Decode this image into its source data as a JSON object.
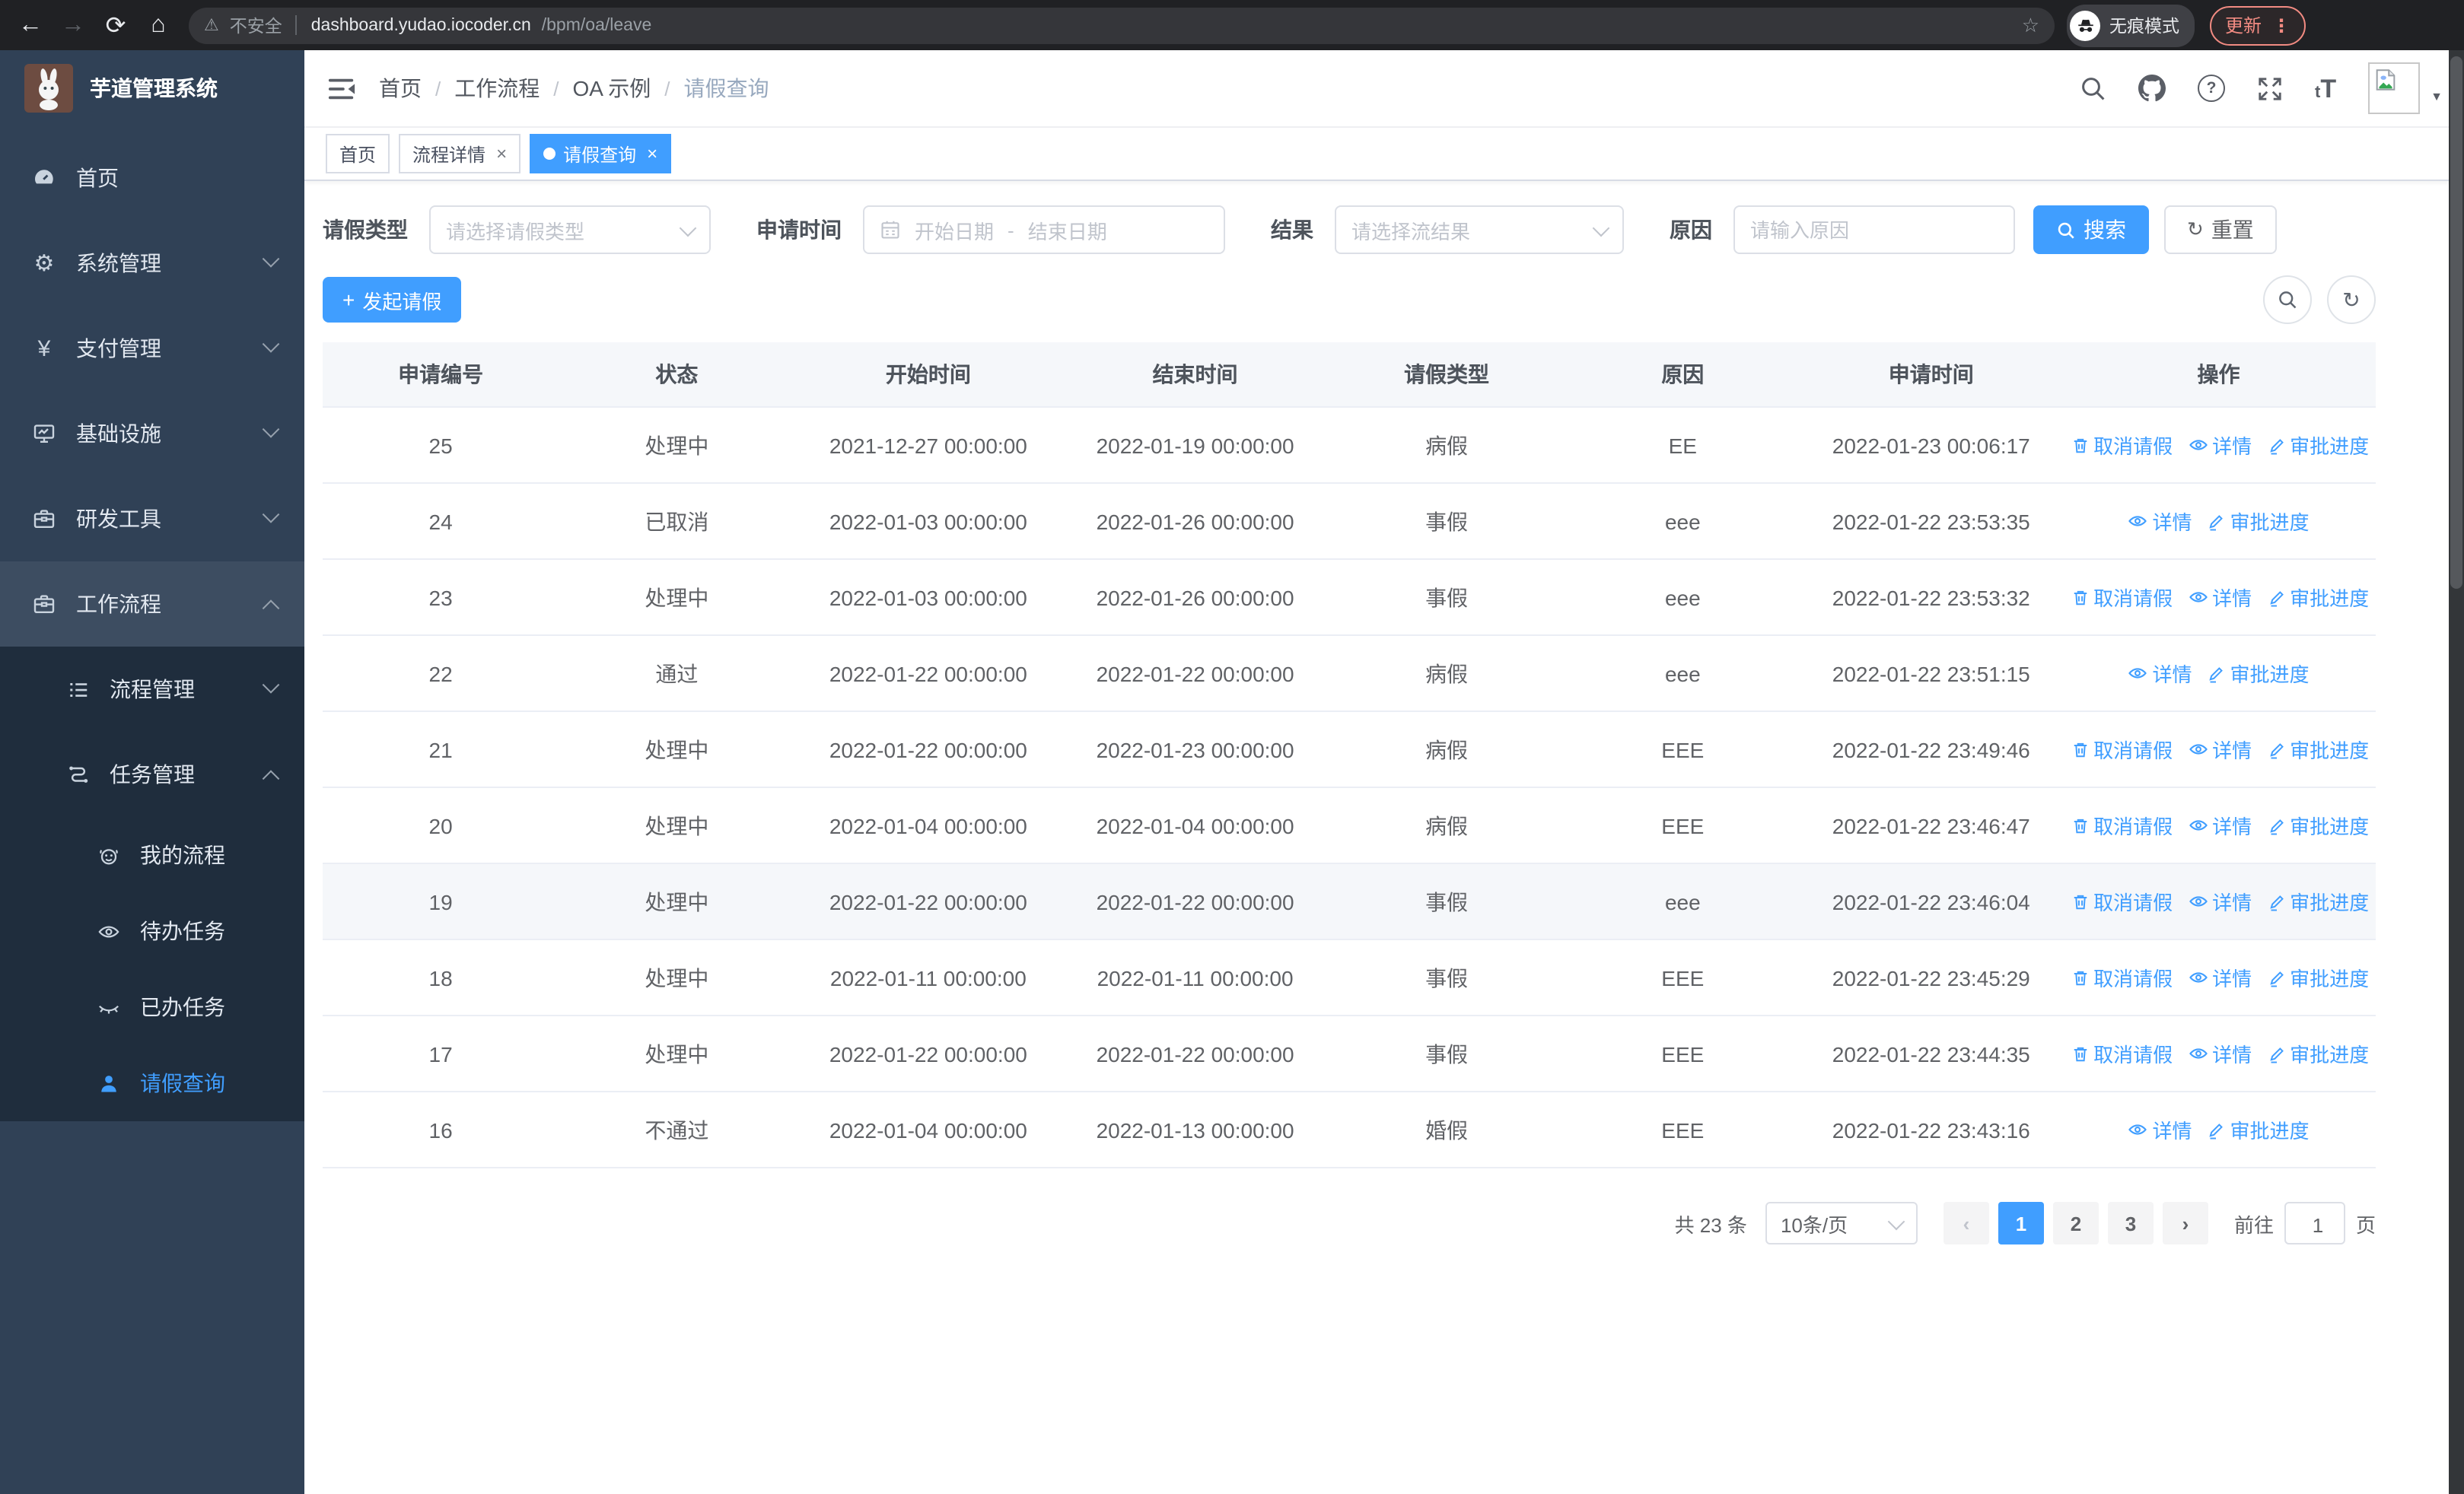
{
  "colors": {
    "primary": "#409eff",
    "sidebar_bg": "#304156",
    "submenu_bg": "#1f2d3d",
    "sidebar_active_text": "#409eff",
    "update_badge": "#f28b82",
    "table_header_bg": "#f5f7fa"
  },
  "icons": {
    "back": "←",
    "forward": "→",
    "reload": "⟳",
    "home": "⌂",
    "warning": "⚠",
    "star": "☆",
    "more": "⋮",
    "caret-down": "▼",
    "gear": "⚙",
    "yen": "¥",
    "plus": "+",
    "refresh": "↻",
    "prev": "‹",
    "next": "›",
    "font-size": "tT",
    "question": "?"
  },
  "browser": {
    "security_label": "不安全",
    "url_host": "dashboard.yudao.iocoder.cn",
    "url_path": "/bpm/oa/leave",
    "incognito_label": "无痕模式",
    "update_label": "更新"
  },
  "sidebar": {
    "title": "芋道管理系统",
    "menu": [
      {
        "label": "首页"
      },
      {
        "label": "系统管理"
      },
      {
        "label": "支付管理"
      },
      {
        "label": "基础设施"
      },
      {
        "label": "研发工具"
      },
      {
        "label": "工作流程"
      }
    ],
    "submenu": [
      {
        "label": "流程管理"
      },
      {
        "label": "任务管理"
      }
    ],
    "task_children": [
      {
        "label": "我的流程"
      },
      {
        "label": "待办任务"
      },
      {
        "label": "已办任务"
      },
      {
        "label": "请假查询"
      }
    ]
  },
  "navbar": {
    "breadcrumb": {
      "items": [
        "首页",
        "工作流程",
        "OA 示例",
        "请假查询"
      ],
      "separator": "/"
    }
  },
  "tabs": [
    {
      "label": "首页"
    },
    {
      "label": "流程详情",
      "close": "×"
    },
    {
      "label": "请假查询",
      "close": "×"
    }
  ],
  "filters": {
    "leave_type_label": "请假类型",
    "leave_type_placeholder": "请选择请假类型",
    "apply_time_label": "申请时间",
    "date_start_placeholder": "开始日期",
    "date_separator": "-",
    "date_end_placeholder": "结束日期",
    "result_label": "结果",
    "result_placeholder": "请选择流结果",
    "reason_label": "原因",
    "reason_placeholder": "请输入原因",
    "search_label": "搜索",
    "reset_label": "重置"
  },
  "toolbar": {
    "create_label": "发起请假"
  },
  "table": {
    "columns": [
      "申请编号",
      "状态",
      "开始时间",
      "结束时间",
      "请假类型",
      "原因",
      "申请时间",
      "操作"
    ],
    "column_keys": [
      "id",
      "status",
      "start",
      "end",
      "type",
      "reason",
      "applied"
    ],
    "action_labels": {
      "cancel": "取消请假",
      "detail": "详情",
      "progress": "审批进度"
    },
    "rows": [
      {
        "id": "25",
        "status": "处理中",
        "start": "2021-12-27 00:00:00",
        "end": "2022-01-19 00:00:00",
        "type": "病假",
        "reason": "EE",
        "applied": "2022-01-23 00:06:17",
        "actions": [
          "cancel",
          "detail",
          "progress"
        ]
      },
      {
        "id": "24",
        "status": "已取消",
        "start": "2022-01-03 00:00:00",
        "end": "2022-01-26 00:00:00",
        "type": "事假",
        "reason": "eee",
        "applied": "2022-01-22 23:53:35",
        "actions": [
          "detail",
          "progress"
        ]
      },
      {
        "id": "23",
        "status": "处理中",
        "start": "2022-01-03 00:00:00",
        "end": "2022-01-26 00:00:00",
        "type": "事假",
        "reason": "eee",
        "applied": "2022-01-22 23:53:32",
        "actions": [
          "cancel",
          "detail",
          "progress"
        ]
      },
      {
        "id": "22",
        "status": "通过",
        "start": "2022-01-22 00:00:00",
        "end": "2022-01-22 00:00:00",
        "type": "病假",
        "reason": "eee",
        "applied": "2022-01-22 23:51:15",
        "actions": [
          "detail",
          "progress"
        ]
      },
      {
        "id": "21",
        "status": "处理中",
        "start": "2022-01-22 00:00:00",
        "end": "2022-01-23 00:00:00",
        "type": "病假",
        "reason": "EEE",
        "applied": "2022-01-22 23:49:46",
        "actions": [
          "cancel",
          "detail",
          "progress"
        ]
      },
      {
        "id": "20",
        "status": "处理中",
        "start": "2022-01-04 00:00:00",
        "end": "2022-01-04 00:00:00",
        "type": "病假",
        "reason": "EEE",
        "applied": "2022-01-22 23:46:47",
        "actions": [
          "cancel",
          "detail",
          "progress"
        ]
      },
      {
        "id": "19",
        "status": "处理中",
        "start": "2022-01-22 00:00:00",
        "end": "2022-01-22 00:00:00",
        "type": "事假",
        "reason": "eee",
        "applied": "2022-01-22 23:46:04",
        "actions": [
          "cancel",
          "detail",
          "progress"
        ],
        "highlighted": true
      },
      {
        "id": "18",
        "status": "处理中",
        "start": "2022-01-11 00:00:00",
        "end": "2022-01-11 00:00:00",
        "type": "事假",
        "reason": "EEE",
        "applied": "2022-01-22 23:45:29",
        "actions": [
          "cancel",
          "detail",
          "progress"
        ]
      },
      {
        "id": "17",
        "status": "处理中",
        "start": "2022-01-22 00:00:00",
        "end": "2022-01-22 00:00:00",
        "type": "事假",
        "reason": "EEE",
        "applied": "2022-01-22 23:44:35",
        "actions": [
          "cancel",
          "detail",
          "progress"
        ]
      },
      {
        "id": "16",
        "status": "不通过",
        "start": "2022-01-04 00:00:00",
        "end": "2022-01-13 00:00:00",
        "type": "婚假",
        "reason": "EEE",
        "applied": "2022-01-22 23:43:16",
        "actions": [
          "detail",
          "progress"
        ]
      }
    ]
  },
  "pagination": {
    "total": "共 23 条",
    "page_size": "10条/页",
    "pages": [
      "1",
      "2",
      "3"
    ],
    "active_page": "1",
    "goto_label": "前往",
    "goto_value": "1",
    "unit": "页"
  }
}
